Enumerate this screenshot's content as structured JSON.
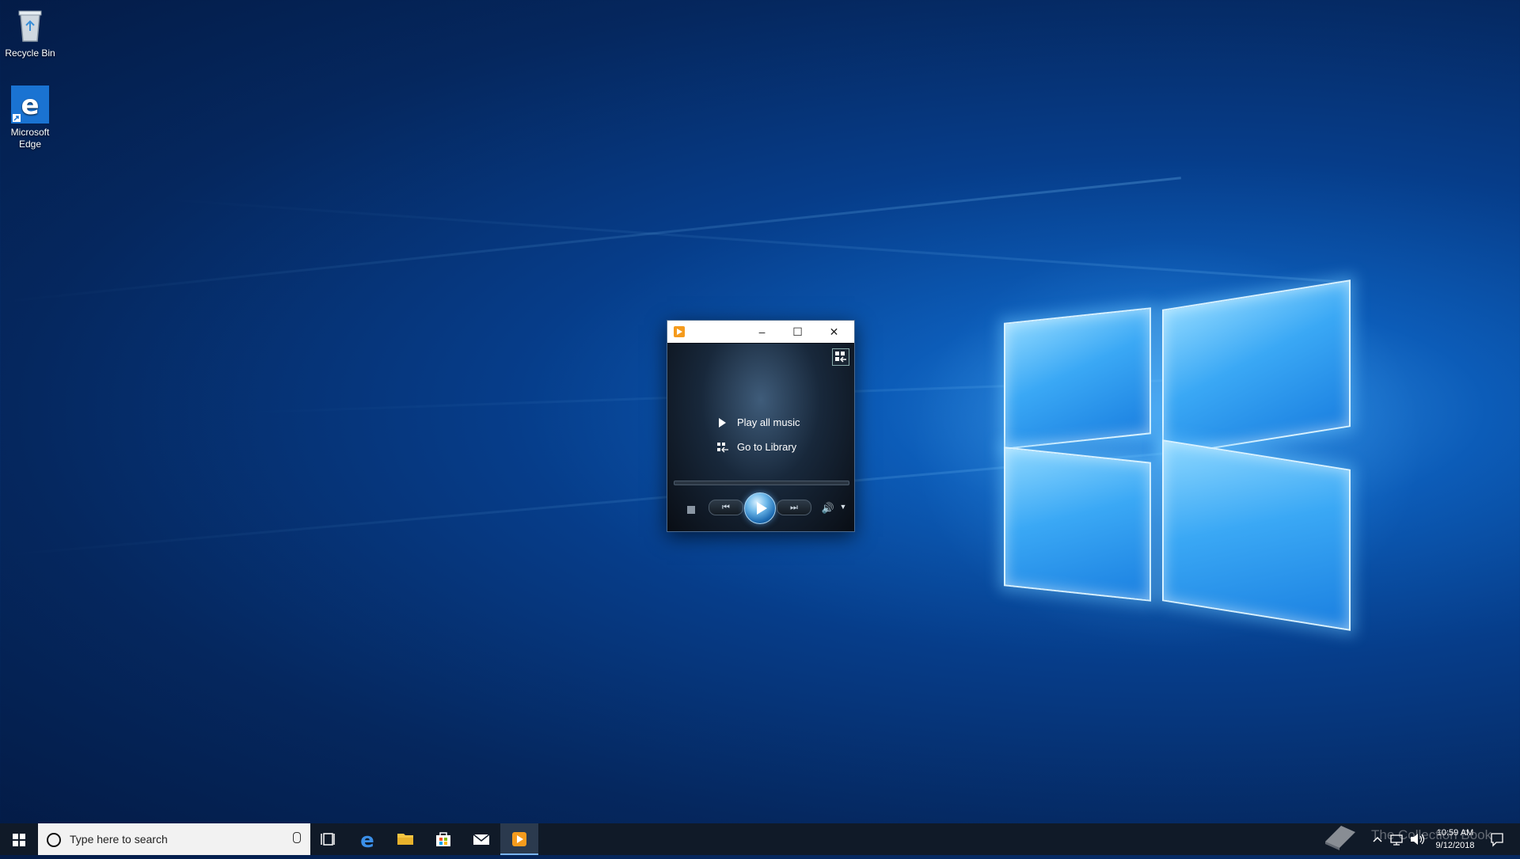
{
  "desktop": {
    "icons": [
      {
        "label": "Recycle Bin"
      },
      {
        "label": "Microsoft Edge"
      }
    ]
  },
  "wmp": {
    "links": {
      "play_all": "Play all music",
      "go_to_library": "Go to Library"
    }
  },
  "taskbar": {
    "search_placeholder": "Type here to search",
    "clock_time": "10:59 AM",
    "clock_date": "9/12/2018"
  },
  "watermark": "The Collection Book",
  "colors": {
    "taskbar_bg": "#101a28",
    "accent": "#7ab4f0",
    "wmp_orange": "#f59b1d"
  }
}
